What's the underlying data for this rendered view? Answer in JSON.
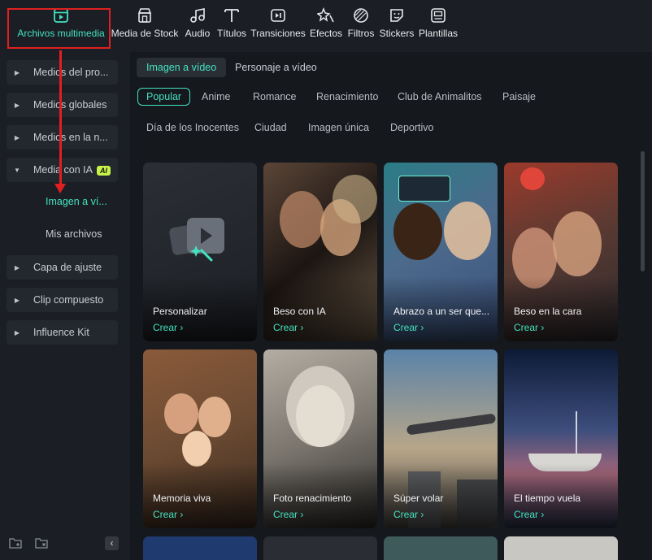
{
  "toolbar": {
    "items": [
      {
        "label": "Archivos multimedia",
        "icon": "media-icon"
      },
      {
        "label": "Media de Stock",
        "icon": "stock-icon"
      },
      {
        "label": "Audio",
        "icon": "music-note-icon"
      },
      {
        "label": "Títulos",
        "icon": "text-icon"
      },
      {
        "label": "Transiciones",
        "icon": "transition-icon"
      },
      {
        "label": "Efectos",
        "icon": "effects-icon"
      },
      {
        "label": "Filtros",
        "icon": "filter-icon"
      },
      {
        "label": "Stickers",
        "icon": "sticker-icon"
      },
      {
        "label": "Plantillas",
        "icon": "template-icon"
      }
    ]
  },
  "sidebar": {
    "items": [
      {
        "label": "Medios del pro..."
      },
      {
        "label": "Medios globales"
      },
      {
        "label": "Medios en la n..."
      },
      {
        "label": "Media con IA",
        "badge": "AI"
      },
      {
        "label": "Capa de ajuste"
      },
      {
        "label": "Clip compuesto"
      },
      {
        "label": "Influence Kit"
      }
    ],
    "subitems": [
      {
        "label": "Imagen a ví..."
      },
      {
        "label": "Mis archivos"
      }
    ]
  },
  "main": {
    "modes": [
      {
        "label": "Imagen a vídeo"
      },
      {
        "label": "Personaje a vídeo"
      }
    ],
    "categories_row1": [
      "Popular",
      "Anime",
      "Romance",
      "Renacimiento",
      "Club de Animalitos",
      "Paisaje"
    ],
    "categories_row2": [
      "Día de los Inocentes",
      "Ciudad",
      "Imagen única",
      "Deportivo"
    ],
    "cta": "Crear",
    "cards": [
      {
        "title": "Personalizar"
      },
      {
        "title": "Beso con IA"
      },
      {
        "title": "Abrazo a un ser que..."
      },
      {
        "title": "Beso en la cara"
      },
      {
        "title": "Memoria viva"
      },
      {
        "title": "Foto renacimiento"
      },
      {
        "title": "Súper volar"
      },
      {
        "title": "El tiempo vuela"
      }
    ]
  },
  "colors": {
    "accent": "#43e2c0",
    "highlight": "#e02020",
    "ai_badge": "#c6f34b"
  }
}
